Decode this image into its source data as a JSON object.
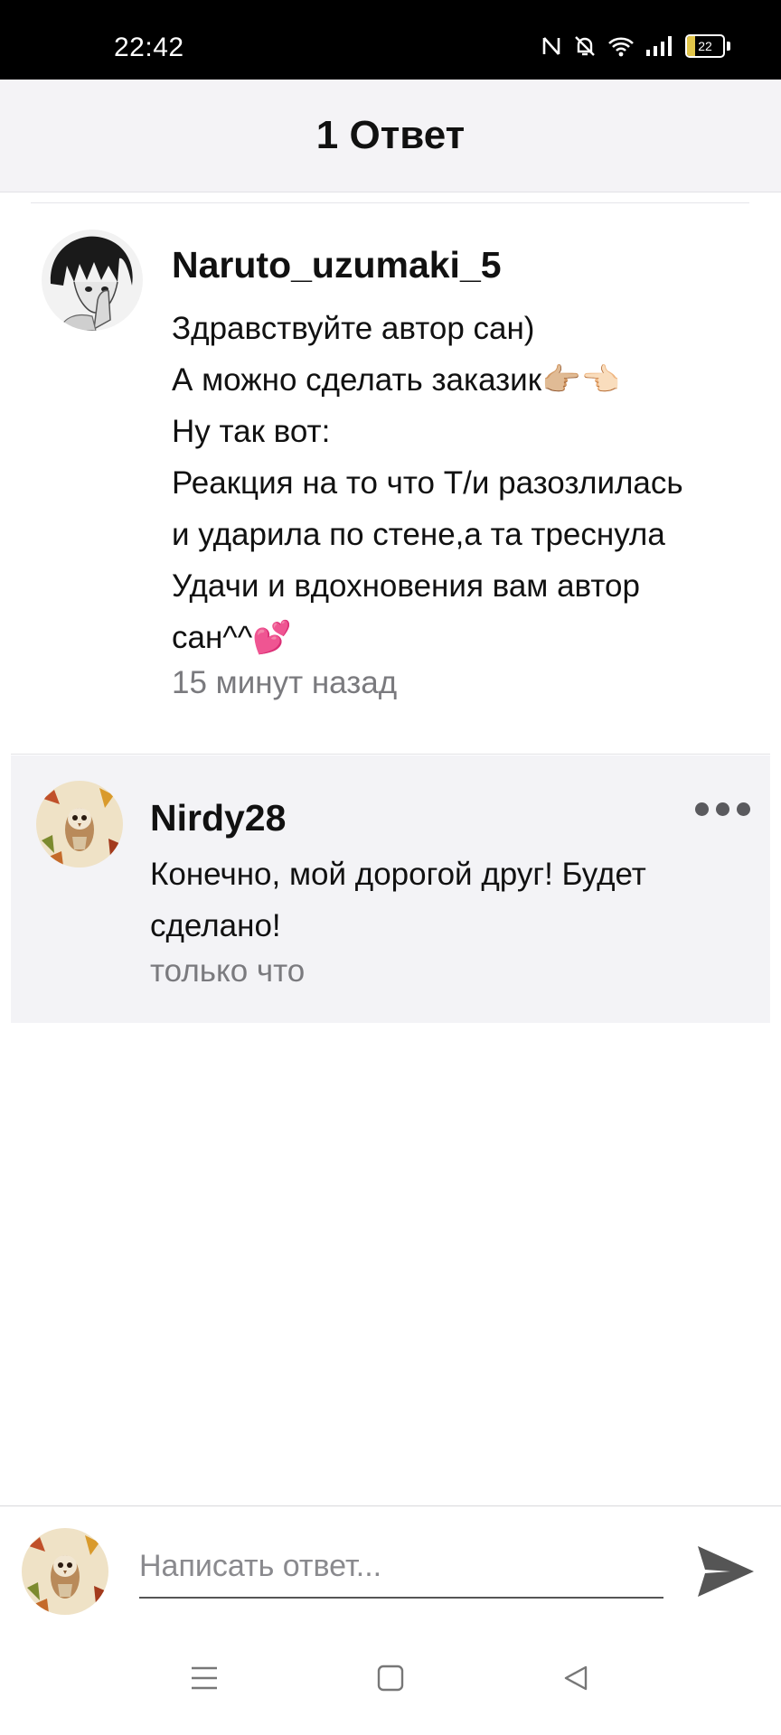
{
  "status_bar": {
    "time": "22:42",
    "battery_level": "22",
    "icons": [
      "nfc-icon",
      "mute-bell-icon",
      "wifi-icon",
      "signal-icon",
      "battery-icon"
    ]
  },
  "header": {
    "title": "1 Ответ"
  },
  "comment": {
    "username": "Naruto_uzumaki_5",
    "lines": [
      "Здравствуйте автор сан)",
      "А можно сделать заказик👉🏼👈🏻",
      "Ну так вот:",
      "Реакция на то что Т/и разозлилась",
      "и ударила по стене,а та треснула",
      "Удачи и вдохновения вам автор",
      "сан^^💕"
    ],
    "time": "15 минут назад"
  },
  "reply": {
    "username": "Nirdy28",
    "lines": [
      "Конечно, мой дорогой друг! Будет",
      "сделано!"
    ],
    "time": "только что"
  },
  "composer": {
    "placeholder": "Написать ответ..."
  },
  "colors": {
    "header_bg": "#f4f3f6",
    "reply_bg": "#f3f3f6",
    "meta_text": "#7a7a7e",
    "send_icon": "#555555"
  }
}
